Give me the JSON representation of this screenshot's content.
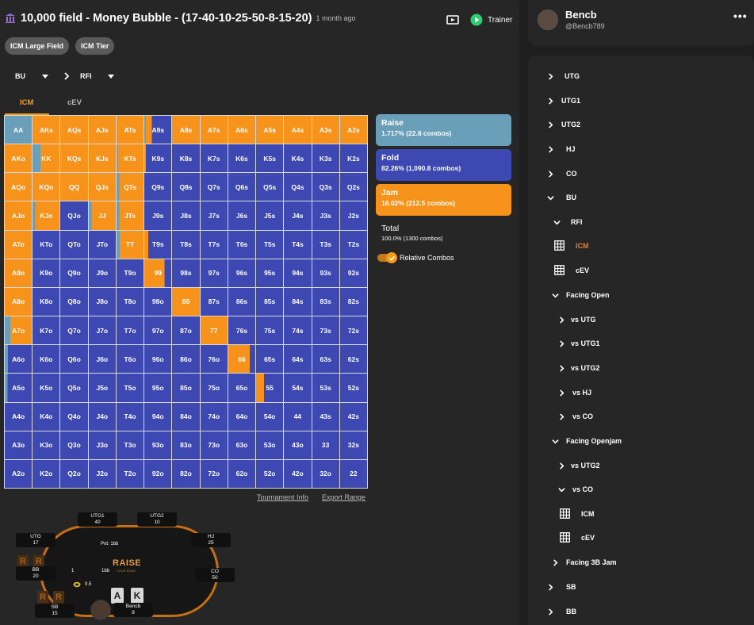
{
  "header": {
    "title": "10,000 field - Money Bubble - (17-40-10-25-50-8-15-20)",
    "subtitle": "1 month ago",
    "trainer_label": "Trainer"
  },
  "tags": [
    "ICM Large Field",
    "ICM Tier"
  ],
  "selectors": {
    "position": "BU",
    "action": "RFI"
  },
  "tabs": {
    "icm": "ICM",
    "cev": "cEV"
  },
  "colors": {
    "raise": "#6a9fba",
    "fold": "#3e48b2",
    "jam": "#f7931a",
    "accent": "#f39c12"
  },
  "legend": {
    "raise": {
      "label": "Raise",
      "value": "1.717% (22.8 combos)"
    },
    "fold": {
      "label": "Fold",
      "value": "82.26% (1,090.8 combos)"
    },
    "jam": {
      "label": "Jam",
      "value": "16.02% (212.5 combos)"
    },
    "total": {
      "label": "Total",
      "value": "100.0% (1300 combos)"
    },
    "relative_combos": "Relative Combos"
  },
  "links": {
    "tournament_info": "Tournament Info",
    "export_range": "Export Range"
  },
  "table": {
    "pot": "Pot: 1bb",
    "brand": "RAISE",
    "brand_sub": "YOUR EDGE",
    "bb_bet": "1",
    "bb_note": "1bb",
    "sb_bet": "0.5",
    "hero_cards": [
      "A",
      "K"
    ],
    "seats": {
      "utg1": {
        "label": "UTG1",
        "stack": "40"
      },
      "utg2": {
        "label": "UTG2",
        "stack": "10"
      },
      "utg": {
        "label": "UTG",
        "stack": "17"
      },
      "hj": {
        "label": "HJ",
        "stack": "25"
      },
      "bb": {
        "label": "BB",
        "stack": "20"
      },
      "co": {
        "label": "CO",
        "stack": "50"
      },
      "sb": {
        "label": "SB",
        "stack": "15"
      },
      "hero": {
        "label": "Bencb",
        "stack": "8"
      }
    }
  },
  "profile": {
    "name": "Bencb",
    "handle": "@Bencb789"
  },
  "nav": {
    "utg": "UTG",
    "utg1": "UTG1",
    "utg2": "UTG2",
    "hj": "HJ",
    "co": "CO",
    "bu": "BU",
    "rfi": "RFI",
    "rfi_icm": "ICM",
    "rfi_cev": "cEV",
    "facing_open": "Facing Open",
    "vs_utg": "vs UTG",
    "vs_utg1": "vs UTG1",
    "vs_utg2": "vs UTG2",
    "vs_hj": "vs HJ",
    "vs_co": "vs CO",
    "facing_openjam": "Facing Openjam",
    "fj_vs_utg2": "vs UTG2",
    "fj_vs_co": "vs CO",
    "fj_icm": "ICM",
    "fj_cev": "cEV",
    "facing_3b_jam": "Facing 3B Jam",
    "sb": "SB",
    "bb": "BB"
  },
  "range_grid": {
    "hands": [
      [
        "AA",
        "AKs",
        "AQs",
        "AJs",
        "ATs",
        "A9s",
        "A8s",
        "A7s",
        "A6s",
        "A5s",
        "A4s",
        "A3s",
        "A2s"
      ],
      [
        "AKo",
        "KK",
        "KQs",
        "KJs",
        "KTs",
        "K9s",
        "K8s",
        "K7s",
        "K6s",
        "K5s",
        "K4s",
        "K3s",
        "K2s"
      ],
      [
        "AQo",
        "KQo",
        "QQ",
        "QJs",
        "QTs",
        "Q9s",
        "Q8s",
        "Q7s",
        "Q6s",
        "Q5s",
        "Q4s",
        "Q3s",
        "Q2s"
      ],
      [
        "AJo",
        "KJo",
        "QJo",
        "JJ",
        "JTs",
        "J9s",
        "J8s",
        "J7s",
        "J6s",
        "J5s",
        "J4s",
        "J3s",
        "J2s"
      ],
      [
        "ATo",
        "KTo",
        "QTo",
        "JTo",
        "TT",
        "T9s",
        "T8s",
        "T7s",
        "T6s",
        "T5s",
        "T4s",
        "T3s",
        "T2s"
      ],
      [
        "A9o",
        "K9o",
        "Q9o",
        "J9o",
        "T9o",
        "99",
        "98s",
        "97s",
        "96s",
        "95s",
        "94s",
        "93s",
        "92s"
      ],
      [
        "A8o",
        "K8o",
        "Q8o",
        "J8o",
        "T8o",
        "98o",
        "88",
        "87s",
        "86s",
        "85s",
        "84s",
        "83s",
        "82s"
      ],
      [
        "A7o",
        "K7o",
        "Q7o",
        "J7o",
        "T7o",
        "97o",
        "87o",
        "77",
        "76s",
        "75s",
        "74s",
        "73s",
        "72s"
      ],
      [
        "A6o",
        "K6o",
        "Q6o",
        "J6o",
        "T6o",
        "96o",
        "86o",
        "76o",
        "66",
        "65s",
        "64s",
        "63s",
        "62s"
      ],
      [
        "A5o",
        "K5o",
        "Q5o",
        "J5o",
        "T5o",
        "95o",
        "85o",
        "75o",
        "65o",
        "55",
        "54s",
        "53s",
        "52s"
      ],
      [
        "A4o",
        "K4o",
        "Q4o",
        "J4o",
        "T4o",
        "94o",
        "84o",
        "74o",
        "64o",
        "54o",
        "44",
        "43s",
        "42s"
      ],
      [
        "A3o",
        "K3o",
        "Q3o",
        "J3o",
        "T3o",
        "93o",
        "83o",
        "73o",
        "63o",
        "53o",
        "43o",
        "33",
        "32s"
      ],
      [
        "A2o",
        "K2o",
        "Q2o",
        "J2o",
        "T2o",
        "92o",
        "82o",
        "72o",
        "62o",
        "52o",
        "42o",
        "32o",
        "22"
      ]
    ],
    "mixed": {
      "AA": {
        "raise": 1.0
      },
      "A9s": {
        "jam": 0.22,
        "raise": 0.06
      },
      "KK": {
        "raise": 0.3,
        "jam": 0.7
      },
      "KTs": {
        "jam": 0.95,
        "raise": 0.05
      },
      "K9s": {
        "jam": 0.06
      },
      "QTs": {
        "jam": 0.9,
        "raise": 0.1
      },
      "KJo": {
        "jam": 0.9,
        "raise": 0.1
      },
      "JJ": {
        "jam": 0.9,
        "raise": 0.1
      },
      "JTs": {
        "jam": 0.9,
        "raise": 0.1
      },
      "TT": {
        "raise": 0.12,
        "jam": 0.88
      },
      "T9s": {
        "jam": 0.14
      },
      "99": {
        "jam": 0.75
      },
      "88": {
        "jam": 1.0
      },
      "77": {
        "jam": 1.0
      },
      "66": {
        "jam": 0.8
      },
      "55": {
        "jam": 0.3
      },
      "A7o": {
        "raise": 0.2,
        "jam": 0.95
      },
      "A6o": {
        "raise": 0.12
      },
      "A5o": {
        "raise": 0.1
      }
    }
  }
}
